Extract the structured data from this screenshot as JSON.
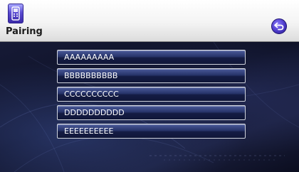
{
  "header": {
    "title": "Pairing",
    "icon": "phone-icon",
    "back_icon": "back-arrow-icon"
  },
  "devices": [
    {
      "label": "AAAAAAAAA"
    },
    {
      "label": "BBBBBBBBBB"
    },
    {
      "label": "CCCCCCCCCC"
    },
    {
      "label": "DDDDDDDDDD"
    },
    {
      "label": "EEEEEEEEEE"
    }
  ],
  "colors": {
    "accent": "#4b39c8",
    "background": "#0d1024",
    "item_border": "#cfd3dd"
  }
}
